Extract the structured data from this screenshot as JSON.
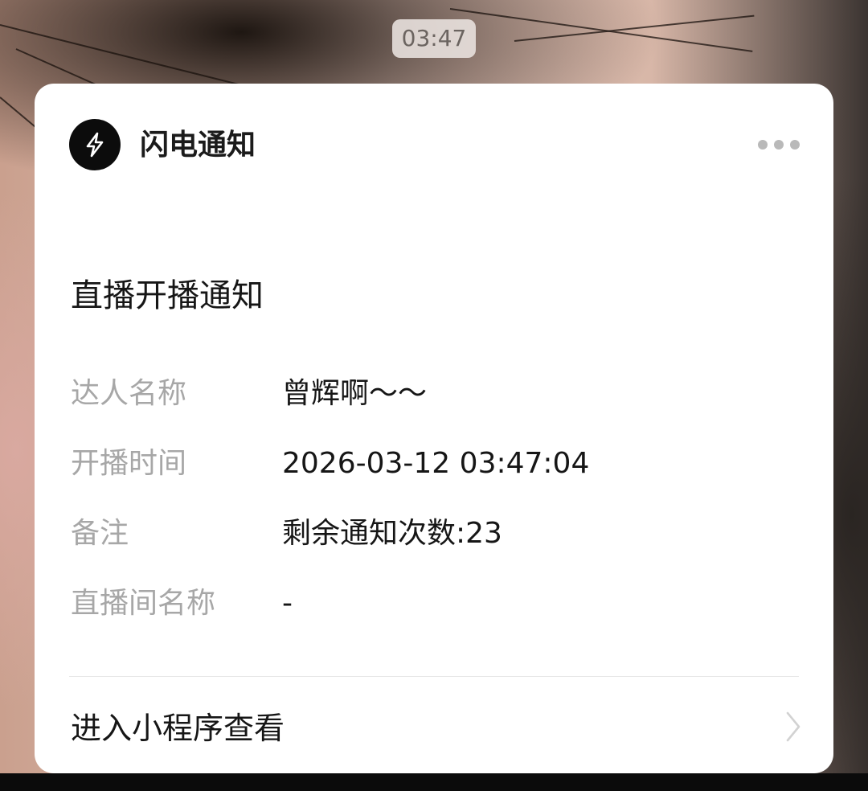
{
  "status": {
    "time": "03:47"
  },
  "notification": {
    "app_name": "闪电通知",
    "app_icon": "lightning-icon",
    "more_icon": "more-dots-icon",
    "title": "直播开播通知",
    "rows": [
      {
        "label": "达人名称",
        "value": "曾辉啊～～"
      },
      {
        "label": "开播时间",
        "value": "2026-03-12 03:47:04"
      },
      {
        "label": "备注",
        "value": "剩余通知次数:23"
      },
      {
        "label": "直播间名称",
        "value": "-"
      }
    ],
    "footer_label": "进入小程序查看",
    "footer_icon": "chevron-right-icon"
  }
}
